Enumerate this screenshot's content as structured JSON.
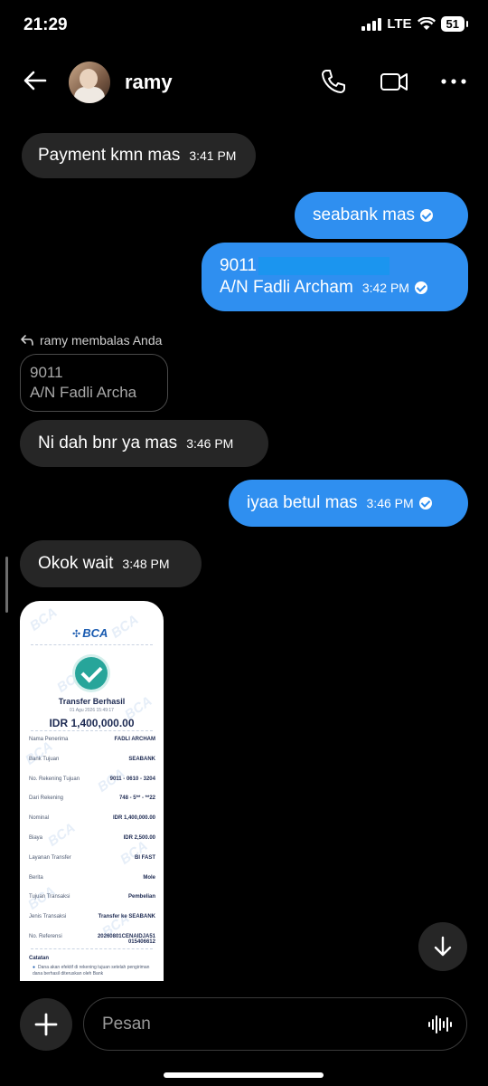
{
  "status_bar": {
    "time": "21:29",
    "network": "LTE",
    "battery": "51"
  },
  "header": {
    "contact_name": "ramy"
  },
  "messages": {
    "m1": {
      "text": "Payment kmn mas",
      "time": "3:41 PM"
    },
    "m2": {
      "text": "seabank mas"
    },
    "m3": {
      "line1": "9011",
      "line2": "A/N Fadli Archam",
      "time": "3:42 PM"
    },
    "reply": {
      "meta": "ramy membalas Anda",
      "quote_line1": "9011",
      "quote_line2": "A/N Fadli Archa"
    },
    "m4": {
      "text": "Ni dah bnr ya mas",
      "time": "3:46 PM"
    },
    "m5": {
      "text": "iyaa betul mas",
      "time": "3:46 PM"
    },
    "m6": {
      "text": "Okok wait",
      "time": "3:48 PM"
    }
  },
  "receipt": {
    "bank": "BCA",
    "title": "Transfer Berhasil",
    "date": "01 Agu 2026 15:49:17",
    "amount": "IDR 1,400,000.00",
    "rows": [
      {
        "label": "Nama Penerima",
        "value": "FADLI ARCHAM"
      },
      {
        "label": "Bank Tujuan",
        "value": "SEABANK"
      },
      {
        "label": "No. Rekening Tujuan",
        "value": "9011 - 0610 - 3204"
      },
      {
        "label": "Dari Rekening",
        "value": "748 - 5** - **22"
      },
      {
        "label": "Nominal",
        "value": "IDR 1,400,000.00"
      },
      {
        "label": "Biaya",
        "value": "IDR 2,500.00"
      },
      {
        "label": "Layanan Transfer",
        "value": "BI FAST"
      },
      {
        "label": "Berita",
        "value": "Mole"
      },
      {
        "label": "Tujuan Transaksi",
        "value": "Pembelian"
      },
      {
        "label": "Jenis Transaksi",
        "value": "Transfer ke SEABANK"
      },
      {
        "label": "No. Referensi",
        "value": "20260801CENAIDJA51 015406612"
      }
    ],
    "note_title": "Catatan",
    "note_text": "Dana akan efektif di rekening tujuan setelah pengiriman dana berhasil diteruskan oleh Bank"
  },
  "composer": {
    "placeholder": "Pesan"
  },
  "colors": {
    "outgoing": "#2f8ff0",
    "incoming": "#262626",
    "background": "#000000"
  },
  "icons": [
    "back-arrow-icon",
    "phone-icon",
    "video-icon",
    "more-icon",
    "reply-icon",
    "check-icon",
    "chevron-down-icon",
    "plus-icon",
    "voice-icon"
  ]
}
